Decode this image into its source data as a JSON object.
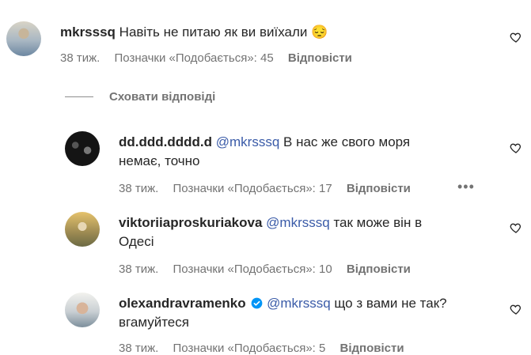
{
  "comments": [
    {
      "username": "mkrsssq",
      "text": "Навіть не питаю як ви виїхали",
      "emoji": "😔",
      "mention": "",
      "time": "38 тиж.",
      "likes": "Позначки «Подобається»: 45",
      "reply": "Відповісти"
    },
    {
      "username": "dd.ddd.dddd.d",
      "mention": "@mkrsssq",
      "text_line1": "В нас же свого моря",
      "text_line2": "немає, точно",
      "time": "38 тиж.",
      "likes": "Позначки «Подобається»: 17",
      "reply": "Відповісти",
      "more": "•••"
    },
    {
      "username": "viktoriiaproskuriakova",
      "mention": "@mkrsssq",
      "text_line1": "так може він в",
      "text_line2": "Одесі",
      "time": "38 тиж.",
      "likes": "Позначки «Подобається»: 10",
      "reply": "Відповісти"
    },
    {
      "username": "olexandravramenko",
      "mention": "@mkrsssq",
      "text_line1": "що з вами не так?",
      "text_line2": "вгамуйтеся",
      "time": "38 тиж.",
      "likes": "Позначки «Подобається»: 5",
      "reply": "Відповісти",
      "verified": true
    }
  ],
  "hide_replies_label": "Сховати відповіді",
  "colors": {
    "mention": "#3a5ba8",
    "meta": "#737373",
    "verified": "#0095f6"
  }
}
